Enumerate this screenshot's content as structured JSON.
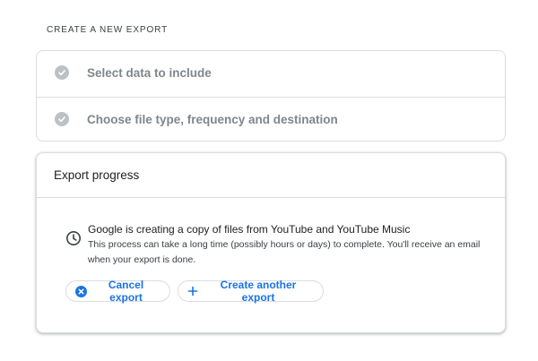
{
  "section_title": "CREATE A NEW EXPORT",
  "steps": [
    {
      "label": "Select data to include",
      "icon": "check-circle-icon",
      "completed": true
    },
    {
      "label": "Choose file type, frequency and destination",
      "icon": "check-circle-icon",
      "completed": true
    }
  ],
  "progress": {
    "title": "Export progress",
    "status_icon": "clock-icon",
    "message": "Google is creating a copy of files from YouTube and YouTube Music",
    "detail": "This process can take a long time (possibly hours or days) to complete. You'll receive an email when your export is done.",
    "cancel_label": "Cancel export",
    "create_label": "Create another export"
  },
  "colors": {
    "accent": "#1a73e8",
    "check_gray": "#bdc1c6",
    "border": "#dadce0"
  }
}
